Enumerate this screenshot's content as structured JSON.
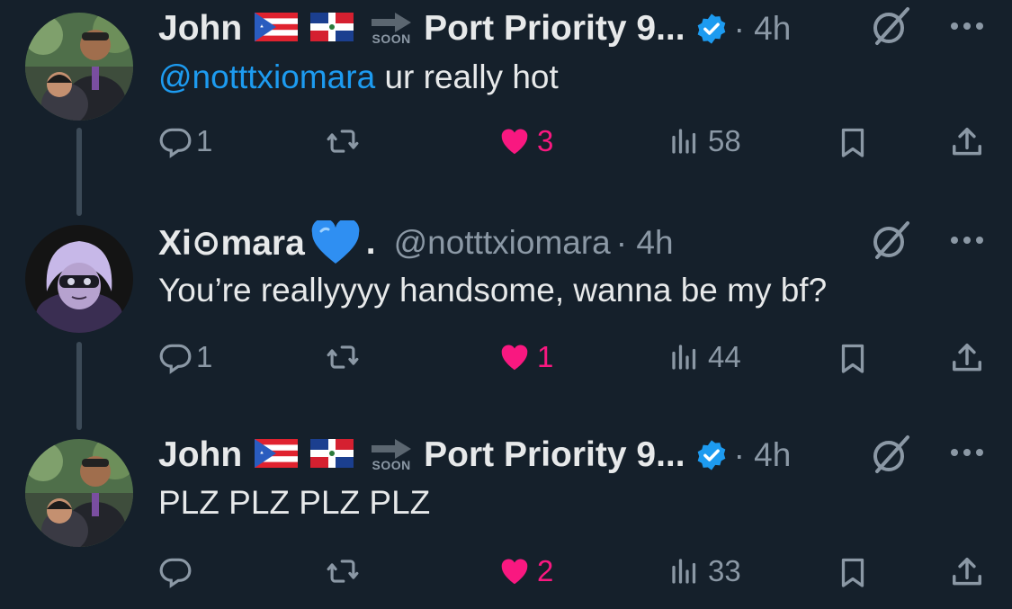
{
  "tweets": [
    {
      "author_name": "John",
      "author_suffix": "Port Priority 9...",
      "soon_label": "SOON",
      "time": "· 4h",
      "mention": "@notttxiomara",
      "text": "ur really hot",
      "reply_count": "1",
      "like_count": "3",
      "view_count": "58",
      "liked": true,
      "verified": true
    },
    {
      "author_name": "Xi⊙mara",
      "author_name_end": ".",
      "handle": "@notttxiomara",
      "time": "· 4h",
      "text": "You’re reallyyyy handsome, wanna be my bf?",
      "reply_count": "1",
      "like_count": "1",
      "view_count": "44",
      "liked": true,
      "emoji": "blue-heart"
    },
    {
      "author_name": "John",
      "author_suffix": "Port Priority 9...",
      "soon_label": "SOON",
      "time": "· 4h",
      "text": "PLZ PLZ PLZ PLZ",
      "reply_count": "",
      "like_count": "2",
      "view_count": "33",
      "liked": true,
      "verified": true
    }
  ],
  "colors": {
    "background": "#15202b",
    "like_pink": "#f91880",
    "link_blue": "#1d9bf0",
    "secondary_text": "#8b98a5",
    "verified_blue": "#1d9bf0"
  },
  "icons": [
    "reply-icon",
    "retweet-icon",
    "heart-icon",
    "views-icon",
    "bookmark-icon",
    "share-icon",
    "grok-icon",
    "more-icon",
    "verified-badge-icon",
    "puerto-rico-flag-icon",
    "dominican-flag-icon",
    "soon-arrow-icon",
    "blue-heart-icon"
  ]
}
